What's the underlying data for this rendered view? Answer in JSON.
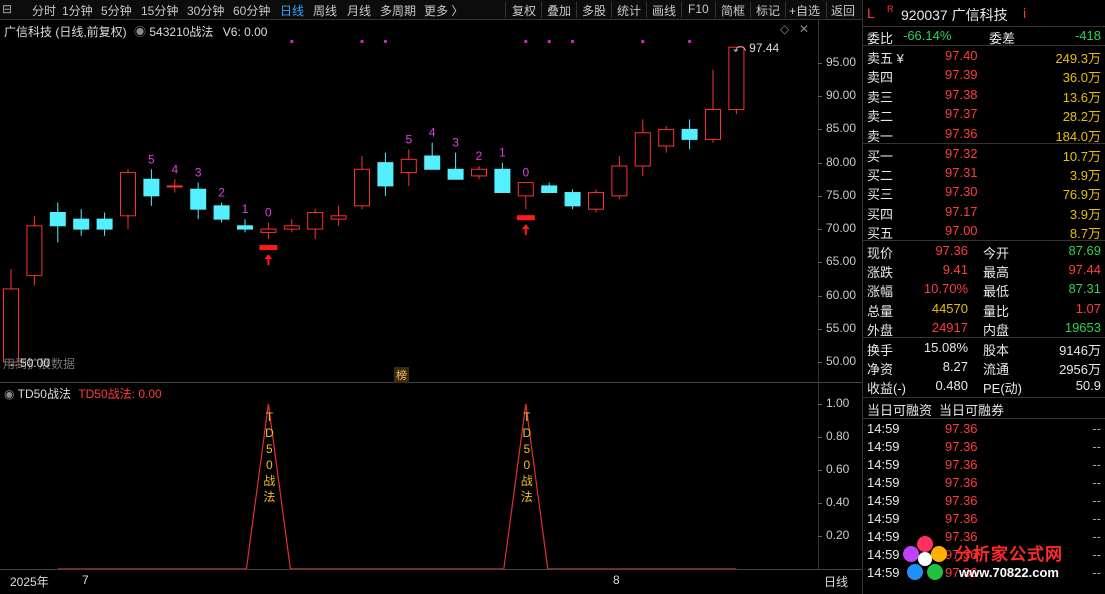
{
  "toolbar": {
    "left_items": [
      {
        "label": "分时",
        "active": false
      },
      {
        "label": "1分钟",
        "active": false
      },
      {
        "label": "5分钟",
        "active": false
      },
      {
        "label": "15分钟",
        "active": false
      },
      {
        "label": "30分钟",
        "active": false
      },
      {
        "label": "60分钟",
        "active": false
      },
      {
        "label": "日线",
        "active": true
      },
      {
        "label": "周线",
        "active": false
      },
      {
        "label": "月线",
        "active": false
      },
      {
        "label": "多周期",
        "active": false
      },
      {
        "label": "更多 〉",
        "active": false
      }
    ],
    "right_items": [
      "复权",
      "叠加",
      "多股",
      "统计",
      "画线",
      "F10",
      "简框",
      "标记",
      "+自选",
      "返回"
    ]
  },
  "main_chart": {
    "title": "广信科技 (日线,前复权)",
    "formula": "543210战法",
    "v6": "V6: 0.00",
    "high_label": "97.44",
    "low_label": "50.00",
    "overlay_text": "用到扩展数据",
    "rank_badge": "榜",
    "ticks": [
      "95.00",
      "90.00",
      "85.00",
      "80.00",
      "75.00",
      "70.00",
      "65.00",
      "60.00",
      "55.00",
      "50.00"
    ]
  },
  "indicator": {
    "title": "TD50战法",
    "value_label": "TD50战法: 0.00",
    "peak_text": [
      "T",
      "D",
      "5",
      "0",
      "战",
      "法"
    ],
    "ticks": [
      "1.00",
      "0.80",
      "0.60",
      "0.40",
      "0.20"
    ]
  },
  "time_axis": {
    "year": "2025年",
    "m7": "7",
    "m8": "8",
    "period": "日线"
  },
  "chart_data": {
    "type": "candlestick",
    "candles": [
      {
        "o": 50.0,
        "h": 64.0,
        "l": 50.0,
        "c": 61.0
      },
      {
        "o": 63.0,
        "h": 72.0,
        "l": 61.5,
        "c": 70.5
      },
      {
        "o": 72.5,
        "h": 74.0,
        "l": 68.0,
        "c": 70.5
      },
      {
        "o": 71.5,
        "h": 73.0,
        "l": 69.0,
        "c": 70.0
      },
      {
        "o": 71.5,
        "h": 72.5,
        "l": 69.0,
        "c": 70.0
      },
      {
        "o": 72.0,
        "h": 79.0,
        "l": 70.0,
        "c": 78.5
      },
      {
        "o": 77.5,
        "h": 79.0,
        "l": 73.5,
        "c": 75.0
      },
      {
        "o": 76.5,
        "h": 77.5,
        "l": 75.5,
        "c": 76.5
      },
      {
        "o": 76.0,
        "h": 77.0,
        "l": 71.5,
        "c": 73.0
      },
      {
        "o": 73.5,
        "h": 74.0,
        "l": 71.0,
        "c": 71.5
      },
      {
        "o": 70.5,
        "h": 71.5,
        "l": 69.5,
        "c": 70.0
      },
      {
        "o": 69.5,
        "h": 71.0,
        "l": 68.5,
        "c": 70.0
      },
      {
        "o": 70.0,
        "h": 71.5,
        "l": 69.5,
        "c": 70.5
      },
      {
        "o": 70.0,
        "h": 73.0,
        "l": 68.5,
        "c": 72.5
      },
      {
        "o": 71.5,
        "h": 73.5,
        "l": 70.5,
        "c": 72.0
      },
      {
        "o": 73.5,
        "h": 81.0,
        "l": 73.0,
        "c": 79.0
      },
      {
        "o": 80.0,
        "h": 81.5,
        "l": 75.0,
        "c": 76.5
      },
      {
        "o": 78.5,
        "h": 82.0,
        "l": 76.5,
        "c": 80.5
      },
      {
        "o": 81.0,
        "h": 83.0,
        "l": 79.0,
        "c": 79.0
      },
      {
        "o": 79.0,
        "h": 81.5,
        "l": 77.5,
        "c": 77.5
      },
      {
        "o": 78.0,
        "h": 79.5,
        "l": 77.5,
        "c": 79.0
      },
      {
        "o": 79.0,
        "h": 80.0,
        "l": 75.5,
        "c": 75.5
      },
      {
        "o": 75.0,
        "h": 77.0,
        "l": 73.0,
        "c": 77.0
      },
      {
        "o": 76.5,
        "h": 77.0,
        "l": 75.5,
        "c": 75.5
      },
      {
        "o": 75.5,
        "h": 76.0,
        "l": 73.0,
        "c": 73.5
      },
      {
        "o": 73.0,
        "h": 76.0,
        "l": 72.5,
        "c": 75.5
      },
      {
        "o": 75.0,
        "h": 81.0,
        "l": 74.5,
        "c": 79.5
      },
      {
        "o": 79.5,
        "h": 86.5,
        "l": 78.0,
        "c": 84.5
      },
      {
        "o": 82.5,
        "h": 85.5,
        "l": 81.5,
        "c": 85.0
      },
      {
        "o": 85.0,
        "h": 86.5,
        "l": 82.0,
        "c": 83.5
      },
      {
        "o": 83.5,
        "h": 94.0,
        "l": 83.0,
        "c": 88.0
      },
      {
        "o": 88.0,
        "h": 97.44,
        "l": 87.31,
        "c": 97.36
      }
    ],
    "count_labels": [
      {
        "i": 6,
        "t": "5"
      },
      {
        "i": 7,
        "t": "4"
      },
      {
        "i": 8,
        "t": "3"
      },
      {
        "i": 9,
        "t": "2"
      },
      {
        "i": 10,
        "t": "1"
      },
      {
        "i": 11,
        "t": "0"
      },
      {
        "i": 17,
        "t": "5"
      },
      {
        "i": 18,
        "t": "4"
      },
      {
        "i": 19,
        "t": "3"
      },
      {
        "i": 20,
        "t": "2"
      },
      {
        "i": 21,
        "t": "1"
      },
      {
        "i": 22,
        "t": "0"
      }
    ],
    "buy_signals": [
      11,
      22
    ],
    "top_dots": [
      12,
      15,
      16,
      22,
      23,
      24,
      27,
      29
    ],
    "td50_peaks": [
      11,
      22
    ],
    "ylim": [
      48.5,
      98.0
    ]
  },
  "panel": {
    "header": {
      "l": "L",
      "r": "R",
      "code_name": "920037 广信科技",
      "i": "i"
    },
    "weibi": {
      "label": "委比",
      "value": "-66.14%",
      "label2": "委差",
      "value2": "-418"
    },
    "asks": [
      {
        "label": "卖五 ¥",
        "price": "97.40",
        "vol": "249.3万"
      },
      {
        "label": "卖四",
        "price": "97.39",
        "vol": "36.0万"
      },
      {
        "label": "卖三",
        "price": "97.38",
        "vol": "13.6万"
      },
      {
        "label": "卖二",
        "price": "97.37",
        "vol": "28.2万"
      },
      {
        "label": "卖一",
        "price": "97.36",
        "vol": "184.0万"
      }
    ],
    "bids": [
      {
        "label": "买一",
        "price": "97.32",
        "vol": "10.7万"
      },
      {
        "label": "买二",
        "price": "97.31",
        "vol": "3.9万"
      },
      {
        "label": "买三",
        "price": "97.30",
        "vol": "76.9万"
      },
      {
        "label": "买四",
        "price": "97.17",
        "vol": "3.9万"
      },
      {
        "label": "买五",
        "price": "97.00",
        "vol": "8.7万"
      }
    ],
    "quote": [
      {
        "l1": "现价",
        "v1": "97.36",
        "c1": "red",
        "l2": "今开",
        "v2": "87.69",
        "c2": "green"
      },
      {
        "l1": "涨跌",
        "v1": "9.41",
        "c1": "red",
        "l2": "最高",
        "v2": "97.44",
        "c2": "red"
      },
      {
        "l1": "涨幅",
        "v1": "10.70%",
        "c1": "red",
        "l2": "最低",
        "v2": "87.31",
        "c2": "green"
      },
      {
        "l1": "总量",
        "v1": "44570",
        "c1": "yellow",
        "l2": "量比",
        "v2": "1.07",
        "c2": "red"
      },
      {
        "l1": "外盘",
        "v1": "24917",
        "c1": "red",
        "l2": "内盘",
        "v2": "19653",
        "c2": "green"
      }
    ],
    "stats": [
      {
        "l1": "换手",
        "v1": "15.08%",
        "l2": "股本",
        "v2": "9146万"
      },
      {
        "l1": "净资",
        "v1": "8.27",
        "l2": "流通",
        "v2": "2956万"
      },
      {
        "l1": "收益(-)",
        "v1": "0.480",
        "l2": "PE(动)",
        "v2": "50.9"
      }
    ],
    "margin_header": [
      "当日可融资",
      "当日可融券"
    ],
    "ticks": [
      {
        "t": "14:59",
        "p": "97.36",
        "v": "--"
      },
      {
        "t": "14:59",
        "p": "97.36",
        "v": "--"
      },
      {
        "t": "14:59",
        "p": "97.36",
        "v": "--"
      },
      {
        "t": "14:59",
        "p": "97.36",
        "v": "--"
      },
      {
        "t": "14:59",
        "p": "97.36",
        "v": "--"
      },
      {
        "t": "14:59",
        "p": "97.36",
        "v": "--"
      },
      {
        "t": "14:59",
        "p": "97.36",
        "v": "--"
      },
      {
        "t": "14:59",
        "p": "97.36",
        "v": "--"
      },
      {
        "t": "14:59",
        "p": "97.36",
        "v": "--"
      }
    ],
    "watermark": {
      "title": "分析家公式网",
      "url": "www.70822.com"
    }
  },
  "colors": {
    "up": "#ff3030",
    "down": "#54f0ff",
    "count": "#e040e0",
    "signal": "#ff1a1a",
    "dot": "#d020d0",
    "line": "#e03030"
  }
}
